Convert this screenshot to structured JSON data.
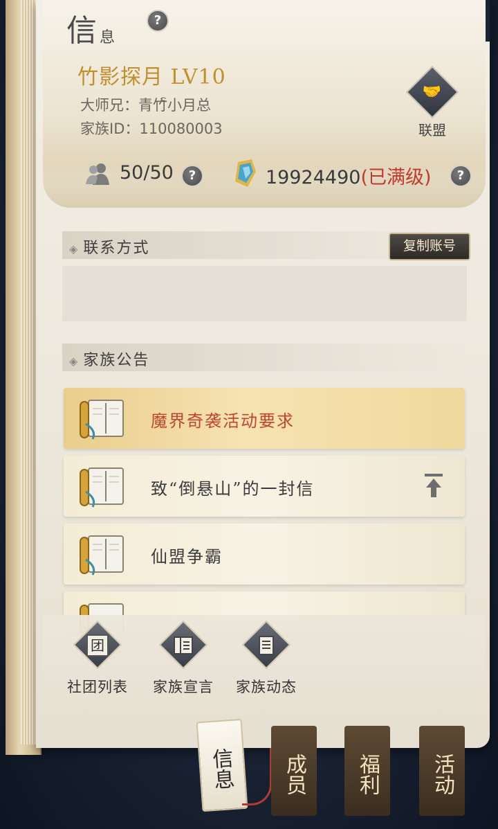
{
  "section_title": {
    "big": "信",
    "small": "息"
  },
  "clan": {
    "name": "竹影探月 LV10",
    "master_label": "大师兄：",
    "master_name": "青竹ꩰ小月总",
    "id_label": "家族ID：",
    "id_value": "110080003"
  },
  "alliance_label": "联盟",
  "members_count": "50/50",
  "funds": {
    "value": "19924490",
    "status": "(已满级)"
  },
  "contact": {
    "header": "联系方式",
    "copy_button": "复制账号"
  },
  "announcements": {
    "header": "家族公告",
    "items": [
      {
        "title": "魔界奇袭活动要求",
        "selected": true
      },
      {
        "title": "致“倒悬山”的一封信",
        "pinned": true
      },
      {
        "title": "仙盟争霸"
      }
    ]
  },
  "quick_actions": [
    {
      "label": "社团列表",
      "icon": "group-icon",
      "glyph": "团"
    },
    {
      "label": "家族宣言",
      "icon": "book-icon",
      "glyph": ""
    },
    {
      "label": "家族动态",
      "icon": "document-icon",
      "glyph": ""
    }
  ],
  "tabs": [
    {
      "label": "信息",
      "active": true
    },
    {
      "label": "成员"
    },
    {
      "label": "福利"
    },
    {
      "label": "活动"
    }
  ],
  "question_mark": "?",
  "colors": {
    "gold": "#c1902c",
    "red": "#c2392b",
    "dark_button": "#2e2a26"
  }
}
